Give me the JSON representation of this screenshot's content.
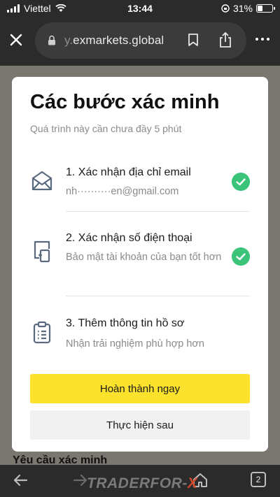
{
  "status_bar": {
    "carrier": "Viettel",
    "time": "13:44",
    "battery": "31%"
  },
  "browser": {
    "url_faded": "y.",
    "url_domain": "exmarkets.global",
    "tab_count": "2"
  },
  "modal": {
    "title": "Các bước xác minh",
    "subtitle": "Quá trình này cần chưa đầy 5 phút",
    "steps": [
      {
        "title": "1. Xác nhận địa chỉ email",
        "desc": "nh··········en@gmail.com",
        "icon": "envelope-icon",
        "completed": true
      },
      {
        "title": "2. Xác nhận số điện thoại",
        "desc": "Bảo mật tài khoản của bạn tốt hơn",
        "icon": "phone-icon",
        "completed": true
      },
      {
        "title": "3. Thêm thông tin hồ sơ",
        "desc": "Nhận trải nghiệm phù hợp hơn",
        "icon": "clipboard-icon",
        "completed": false
      }
    ],
    "primary_button": "Hoàn thành ngay",
    "secondary_button": "Thực hiện sau"
  },
  "background": {
    "peek_text": "Yêu cầu xác minh"
  },
  "watermark": {
    "text": "TRADERFOR-",
    "x": "X"
  },
  "colors": {
    "accent": "#fce22c",
    "success": "#3cc37a",
    "icon": "#5a6a7e"
  }
}
